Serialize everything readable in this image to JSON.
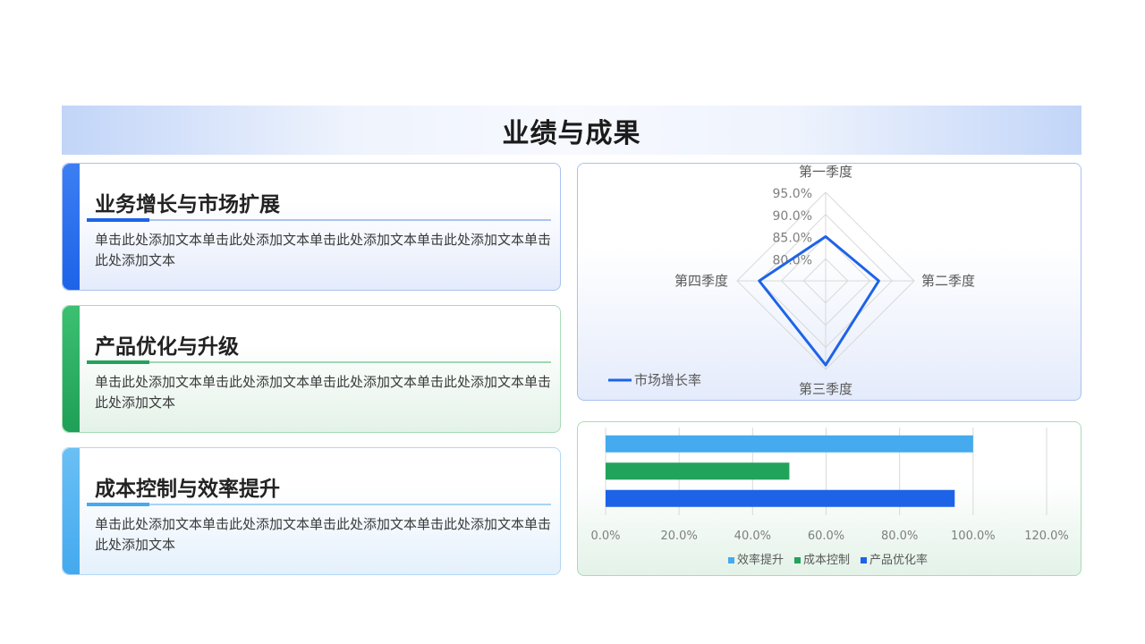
{
  "page": {
    "title": "业绩与成果"
  },
  "cards": [
    {
      "heading": "业务增长与市场扩展",
      "body": "单击此处添加文本单击此处添加文本单击此处添加文本单击此处添加文本单击此处添加文本",
      "accent": "#1d63e8"
    },
    {
      "heading": "产品优化与升级",
      "body": "单击此处添加文本单击此处添加文本单击此处添加文本单击此处添加文本单击此处添加文本",
      "accent": "#22a35b"
    },
    {
      "heading": "成本控制与效率提升",
      "body": "单击此处添加文本单击此处添加文本单击此处添加文本单击此处添加文本单击此处添加文本",
      "accent": "#45aaee"
    }
  ],
  "chart_data": [
    {
      "type": "radar",
      "axes": [
        "第一季度",
        "第二季度",
        "第三季度",
        "第四季度"
      ],
      "rlim": [
        75,
        95
      ],
      "ticks": [
        "80.0%",
        "85.0%",
        "90.0%",
        "95.0%"
      ],
      "series": [
        {
          "name": "市场增长率",
          "values": [
            85,
            87,
            94,
            90
          ],
          "color": "#1d63e8"
        }
      ],
      "legend": "bottom-left"
    },
    {
      "type": "bar",
      "orientation": "horizontal",
      "categories": [
        "效率提升",
        "成本控制",
        "产品优化率"
      ],
      "values": [
        100,
        50,
        95
      ],
      "colors": [
        "#45aaee",
        "#22a35b",
        "#1d63e8"
      ],
      "xlim": [
        0,
        120
      ],
      "xticks": [
        "0.0%",
        "20.0%",
        "40.0%",
        "60.0%",
        "80.0%",
        "100.0%",
        "120.0%"
      ],
      "legend": "bottom"
    }
  ]
}
